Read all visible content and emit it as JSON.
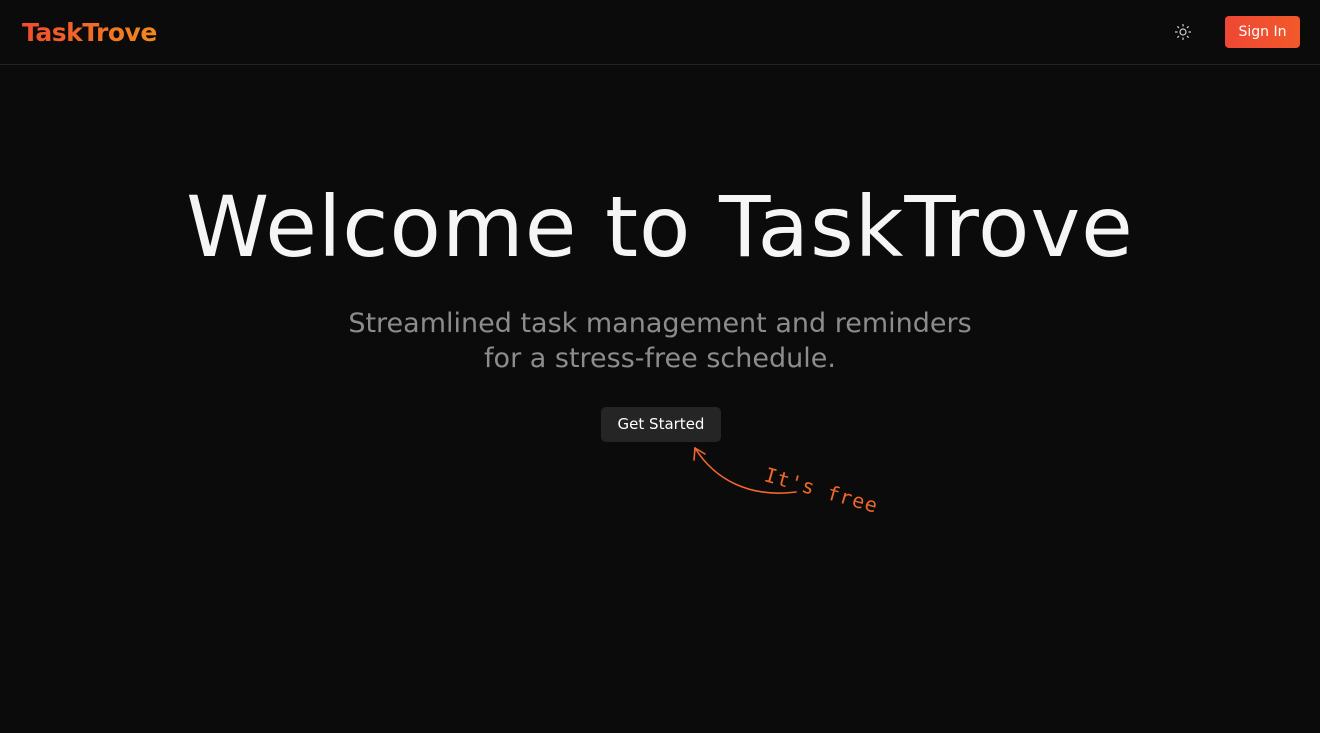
{
  "header": {
    "logo_text": "TaskTrove",
    "theme_toggle_icon": "sun-icon",
    "signin_label": "Sign In"
  },
  "hero": {
    "title": "Welcome to TaskTrove",
    "subtitle_line1": "Streamlined task management and reminders",
    "subtitle_line2": "for a stress-free schedule.",
    "cta_label": "Get Started",
    "annotation_text": "It's free",
    "annotation_icon": "curved-arrow-icon"
  },
  "colors": {
    "background": "#0b0b0b",
    "brand_start": "#f14c2e",
    "brand_end": "#f28a1c",
    "signin_bg": "#ef4734",
    "cta_bg": "#252525",
    "title_text": "#f5f5f5",
    "subtitle_text": "#8c8c8c",
    "annotation": "#f1672a"
  }
}
